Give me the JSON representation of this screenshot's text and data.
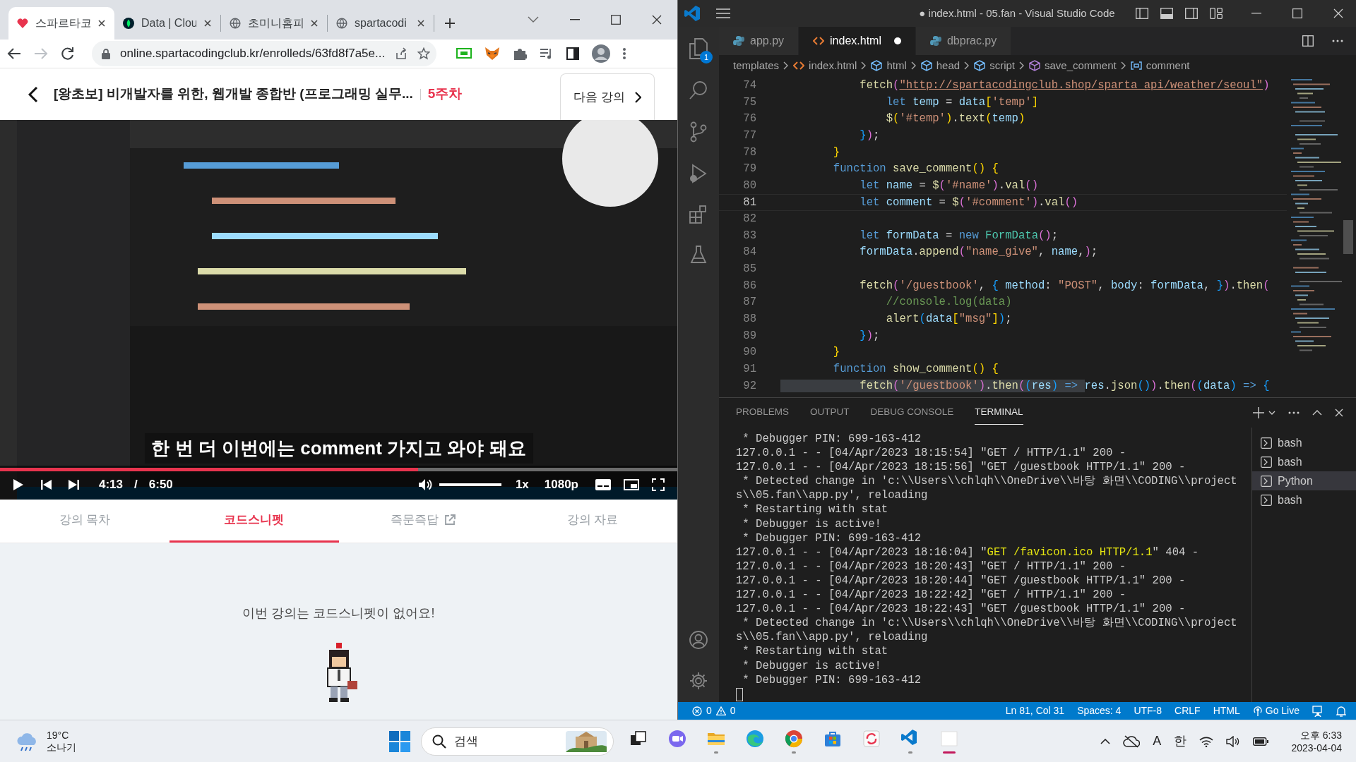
{
  "browser": {
    "tabs": [
      {
        "title": "스파르타코",
        "kind": "sparta",
        "selected": true
      },
      {
        "title": "Data | Clou",
        "kind": "leaf",
        "selected": false
      },
      {
        "title": "초미니홈피",
        "kind": "globe",
        "selected": false
      },
      {
        "title": "spartacodi",
        "kind": "globe",
        "selected": false
      }
    ],
    "nav": [
      {
        "kind": "back",
        "disabled": false
      },
      {
        "kind": "forward",
        "disabled": true
      },
      {
        "kind": "reload",
        "disabled": false
      }
    ],
    "url": "online.spartacodingclub.kr/enrolleds/63fd8f7a5e..."
  },
  "lecture": {
    "title": "[왕초보] 비개발자를 위한, 웹개발 종합반 (프로그래밍 실무...",
    "week": "5주차",
    "next_button": "다음 강의"
  },
  "player": {
    "subtitle": "한 번 더 이번에는 comment 가지고 와야 돼요",
    "progress": {
      "level": 0.617
    },
    "current_time": "4:13",
    "separator": "/",
    "duration": "6:50",
    "volume": {
      "level": 1
    },
    "speed": "1x",
    "quality": "1080p"
  },
  "lecture_tabs": [
    {
      "label": "강의 목차",
      "selected": false,
      "external": false
    },
    {
      "label": "코드스니펫",
      "selected": true,
      "external": false
    },
    {
      "label": "즉문즉답",
      "selected": false,
      "external": true
    },
    {
      "label": "강의 자료",
      "selected": false,
      "external": false
    }
  ],
  "empty_message": "이번 강의는 코드스니펫이 없어요!",
  "vscode": {
    "title": "● index.html - 05.fan - Visual Studio Code",
    "explorer_badge": "1",
    "tabs": [
      {
        "label": "app.py",
        "kind": "python",
        "selected": false,
        "dirty": false
      },
      {
        "label": "index.html",
        "kind": "html",
        "selected": true,
        "dirty": true
      },
      {
        "label": "dbprac.py",
        "kind": "python",
        "selected": false,
        "dirty": false
      }
    ],
    "breadcrumbs": [
      {
        "label": "templates",
        "kind": "folder"
      },
      {
        "label": "index.html",
        "kind": "html"
      },
      {
        "label": "html",
        "kind": "cube"
      },
      {
        "label": "head",
        "kind": "cube"
      },
      {
        "label": "script",
        "kind": "cube"
      },
      {
        "label": "save_comment",
        "kind": "method"
      },
      {
        "label": "comment",
        "kind": "variable"
      }
    ],
    "editor": {
      "lines": [
        {
          "n": "74",
          "current": false,
          "tokens": [
            {
              "text": "            fetch",
              "kind": "f"
            },
            {
              "text": "(",
              "kind": "b2"
            },
            {
              "text": "\"http://spartacodingclub.shop/sparta_api/weather/seoul\"",
              "kind": "u"
            },
            {
              "text": ")",
              "kind": "b2"
            }
          ]
        },
        {
          "n": "75",
          "current": false,
          "tokens": [
            {
              "text": "                let",
              "kind": "k"
            },
            {
              "text": " temp",
              "kind": "v"
            },
            {
              "text": " = ",
              "kind": "p"
            },
            {
              "text": "data",
              "kind": "v"
            },
            {
              "text": "[",
              "kind": "b1"
            },
            {
              "text": "'temp'",
              "kind": "s"
            },
            {
              "text": "]",
              "kind": "b1"
            }
          ]
        },
        {
          "n": "76",
          "current": false,
          "tokens": [
            {
              "text": "                $",
              "kind": "f"
            },
            {
              "text": "(",
              "kind": "b1"
            },
            {
              "text": "'#temp'",
              "kind": "s"
            },
            {
              "text": ")",
              "kind": "b1"
            },
            {
              "text": ".",
              "kind": "p"
            },
            {
              "text": "text",
              "kind": "f"
            },
            {
              "text": "(",
              "kind": "b1"
            },
            {
              "text": "temp",
              "kind": "v"
            },
            {
              "text": ")",
              "kind": "b1"
            }
          ]
        },
        {
          "n": "77",
          "current": false,
          "tokens": [
            {
              "text": "            }",
              "kind": "b3"
            },
            {
              "text": ")",
              "kind": "b2"
            },
            {
              "text": ";",
              "kind": "p"
            }
          ]
        },
        {
          "n": "78",
          "current": false,
          "tokens": [
            {
              "text": "        }",
              "kind": "b1"
            }
          ]
        },
        {
          "n": "79",
          "current": false,
          "tokens": [
            {
              "text": "        function",
              "kind": "k"
            },
            {
              "text": " save_comment",
              "kind": "f"
            },
            {
              "text": "()",
              "kind": "b1"
            },
            {
              "text": " {",
              "kind": "b1"
            }
          ]
        },
        {
          "n": "80",
          "current": false,
          "tokens": [
            {
              "text": "            let",
              "kind": "k"
            },
            {
              "text": " name",
              "kind": "v"
            },
            {
              "text": " = ",
              "kind": "p"
            },
            {
              "text": "$",
              "kind": "f"
            },
            {
              "text": "(",
              "kind": "b2"
            },
            {
              "text": "'#name'",
              "kind": "s"
            },
            {
              "text": ")",
              "kind": "b2"
            },
            {
              "text": ".",
              "kind": "p"
            },
            {
              "text": "val",
              "kind": "f"
            },
            {
              "text": "()",
              "kind": "b2"
            }
          ]
        },
        {
          "n": "81",
          "current": true,
          "tokens": [
            {
              "text": "            let",
              "kind": "k"
            },
            {
              "text": " comment",
              "kind": "v"
            },
            {
              "text": " = ",
              "kind": "p"
            },
            {
              "text": "$",
              "kind": "f"
            },
            {
              "text": "(",
              "kind": "b2"
            },
            {
              "text": "'#comment'",
              "kind": "s"
            },
            {
              "text": ")",
              "kind": "b2"
            },
            {
              "text": ".",
              "kind": "p"
            },
            {
              "text": "val",
              "kind": "f"
            },
            {
              "text": "()",
              "kind": "b2"
            }
          ]
        },
        {
          "n": "82",
          "current": false
        },
        {
          "n": "83",
          "current": false,
          "tokens": [
            {
              "text": "            let",
              "kind": "k"
            },
            {
              "text": " formData",
              "kind": "v"
            },
            {
              "text": " = ",
              "kind": "p"
            },
            {
              "text": "new",
              "kind": "k"
            },
            {
              "text": " FormData",
              "kind": "c"
            },
            {
              "text": "()",
              "kind": "b2"
            },
            {
              "text": ";",
              "kind": "p"
            }
          ]
        },
        {
          "n": "84",
          "current": false,
          "tokens": [
            {
              "text": "            formData",
              "kind": "v"
            },
            {
              "text": ".",
              "kind": "p"
            },
            {
              "text": "append",
              "kind": "f"
            },
            {
              "text": "(",
              "kind": "b2"
            },
            {
              "text": "\"name_give\"",
              "kind": "s"
            },
            {
              "text": ", ",
              "kind": "p"
            },
            {
              "text": "name",
              "kind": "v"
            },
            {
              "text": ",",
              "kind": "p"
            },
            {
              "text": ")",
              "kind": "b2"
            },
            {
              "text": ";",
              "kind": "p"
            }
          ]
        },
        {
          "n": "85",
          "current": false
        },
        {
          "n": "86",
          "current": false,
          "tokens": [
            {
              "text": "            fetch",
              "kind": "f"
            },
            {
              "text": "(",
              "kind": "b2"
            },
            {
              "text": "'/guestbook'",
              "kind": "s"
            },
            {
              "text": ", ",
              "kind": "p"
            },
            {
              "text": "{",
              "kind": "b3"
            },
            {
              "text": " method",
              "kind": "v"
            },
            {
              "text": ": ",
              "kind": "p"
            },
            {
              "text": "\"POST\"",
              "kind": "s"
            },
            {
              "text": ", ",
              "kind": "p"
            },
            {
              "text": "body",
              "kind": "v"
            },
            {
              "text": ": ",
              "kind": "p"
            },
            {
              "text": "formData",
              "kind": "v"
            },
            {
              "text": ", ",
              "kind": "p"
            },
            {
              "text": "}",
              "kind": "b3"
            },
            {
              "text": ")",
              "kind": "b2"
            },
            {
              "text": ".",
              "kind": "p"
            },
            {
              "text": "then",
              "kind": "f"
            },
            {
              "text": "(",
              "kind": "b2"
            }
          ]
        },
        {
          "n": "87",
          "current": false,
          "tokens": [
            {
              "text": "                //console.log(data)",
              "kind": "m"
            }
          ]
        },
        {
          "n": "88",
          "current": false,
          "tokens": [
            {
              "text": "                alert",
              "kind": "f"
            },
            {
              "text": "(",
              "kind": "b3"
            },
            {
              "text": "data",
              "kind": "v"
            },
            {
              "text": "[",
              "kind": "b1"
            },
            {
              "text": "\"msg\"",
              "kind": "s"
            },
            {
              "text": "]",
              "kind": "b1"
            },
            {
              "text": ")",
              "kind": "b3"
            },
            {
              "text": ";",
              "kind": "p"
            }
          ]
        },
        {
          "n": "89",
          "current": false,
          "tokens": [
            {
              "text": "            }",
              "kind": "b3"
            },
            {
              "text": ")",
              "kind": "b2"
            },
            {
              "text": ";",
              "kind": "p"
            }
          ]
        },
        {
          "n": "90",
          "current": false,
          "tokens": [
            {
              "text": "        }",
              "kind": "b1"
            }
          ]
        },
        {
          "n": "91",
          "current": false,
          "tokens": [
            {
              "text": "        function",
              "kind": "k"
            },
            {
              "text": " show_comment",
              "kind": "f"
            },
            {
              "text": "()",
              "kind": "b1"
            },
            {
              "text": " {",
              "kind": "b1"
            }
          ]
        },
        {
          "n": "92",
          "current": false,
          "selection": [
            {
              "text": "            fetch",
              "kind": "f"
            },
            {
              "text": "(",
              "kind": "b2"
            },
            {
              "text": "'/guestbook'",
              "kind": "s"
            },
            {
              "text": ")",
              "kind": "b2"
            },
            {
              "text": ".",
              "kind": "p"
            },
            {
              "text": "then",
              "kind": "f"
            },
            {
              "text": "(",
              "kind": "b2"
            },
            {
              "text": "(",
              "kind": "b3"
            },
            {
              "text": "res",
              "kind": "v"
            },
            {
              "text": ")",
              "kind": "b3"
            },
            {
              "text": " => ",
              "kind": "k"
            }
          ],
          "tokens": [
            {
              "text": "res",
              "kind": "v"
            },
            {
              "text": ".",
              "kind": "p"
            },
            {
              "text": "json",
              "kind": "f"
            },
            {
              "text": "()",
              "kind": "b3"
            },
            {
              "text": ")",
              "kind": "b2"
            },
            {
              "text": ".",
              "kind": "p"
            },
            {
              "text": "then",
              "kind": "f"
            },
            {
              "text": "(",
              "kind": "b2"
            },
            {
              "text": "(",
              "kind": "b3"
            },
            {
              "text": "data",
              "kind": "v"
            },
            {
              "text": ")",
              "kind": "b3"
            },
            {
              "text": " => ",
              "kind": "k"
            },
            {
              "text": "{",
              "kind": "b3"
            }
          ]
        }
      ]
    },
    "panel": {
      "tabs": [
        {
          "label": "PROBLEMS",
          "selected": false
        },
        {
          "label": "OUTPUT",
          "selected": false
        },
        {
          "label": "DEBUG CONSOLE",
          "selected": false
        },
        {
          "label": "TERMINAL",
          "selected": true
        }
      ],
      "terminal_lines": [
        {
          "parts": [
            {
              "text": " * Debugger PIN: 699-163-412",
              "kind": "plain"
            }
          ]
        },
        {
          "parts": [
            {
              "text": "127.0.0.1 - - [04/Apr/2023 18:15:54] \"GET / HTTP/1.1\" 200 -",
              "kind": "plain"
            }
          ]
        },
        {
          "parts": [
            {
              "text": "127.0.0.1 - - [04/Apr/2023 18:15:56] \"GET /guestbook HTTP/1.1\" 200 -",
              "kind": "plain"
            }
          ]
        },
        {
          "parts": [
            {
              "text": " * Detected change in 'c:\\\\Users\\\\chlqh\\\\OneDrive\\\\바탕 화면\\\\CODING\\\\project",
              "kind": "plain"
            }
          ]
        },
        {
          "parts": [
            {
              "text": "s\\\\05.fan\\\\app.py', reloading",
              "kind": "plain"
            }
          ]
        },
        {
          "parts": [
            {
              "text": " * Restarting with stat",
              "kind": "plain"
            }
          ]
        },
        {
          "parts": [
            {
              "text": " * Debugger is active!",
              "kind": "plain"
            }
          ]
        },
        {
          "parts": [
            {
              "text": " * Debugger PIN: 699-163-412",
              "kind": "plain"
            }
          ]
        },
        {
          "parts": [
            {
              "text": "127.0.0.1 - - [04/Apr/2023 18:16:04] \"",
              "kind": "plain"
            },
            {
              "text": "GET /favicon.ico HTTP/1.1",
              "kind": "warn"
            },
            {
              "text": "\" 404 -",
              "kind": "plain"
            }
          ]
        },
        {
          "parts": [
            {
              "text": "127.0.0.1 - - [04/Apr/2023 18:20:43] \"GET / HTTP/1.1\" 200 -",
              "kind": "plain"
            }
          ]
        },
        {
          "parts": [
            {
              "text": "127.0.0.1 - - [04/Apr/2023 18:20:44] \"GET /guestbook HTTP/1.1\" 200 -",
              "kind": "plain"
            }
          ]
        },
        {
          "parts": [
            {
              "text": "127.0.0.1 - - [04/Apr/2023 18:22:42] \"GET / HTTP/1.1\" 200 -",
              "kind": "plain"
            }
          ]
        },
        {
          "parts": [
            {
              "text": "127.0.0.1 - - [04/Apr/2023 18:22:43] \"GET /guestbook HTTP/1.1\" 200 -",
              "kind": "plain"
            }
          ]
        },
        {
          "parts": [
            {
              "text": " * Detected change in 'c:\\\\Users\\\\chlqh\\\\OneDrive\\\\바탕 화면\\\\CODING\\\\project",
              "kind": "plain"
            }
          ]
        },
        {
          "parts": [
            {
              "text": "s\\\\05.fan\\\\app.py', reloading",
              "kind": "plain"
            }
          ]
        },
        {
          "parts": [
            {
              "text": " * Restarting with stat",
              "kind": "plain"
            }
          ]
        },
        {
          "parts": [
            {
              "text": " * Debugger is active!",
              "kind": "plain"
            }
          ]
        },
        {
          "parts": [
            {
              "text": " * Debugger PIN: 699-163-412",
              "kind": "plain"
            }
          ]
        }
      ],
      "terminals": [
        {
          "label": "bash",
          "selected": false
        },
        {
          "label": "bash",
          "selected": false
        },
        {
          "label": "Python",
          "selected": true
        },
        {
          "label": "bash",
          "selected": false
        }
      ]
    },
    "status_bar": {
      "errors": "0",
      "warnings": "0",
      "items": [
        "Ln 81, Col 31",
        "Spaces: 4",
        "UTF-8",
        "CRLF",
        "HTML"
      ],
      "go_live": "Go Live"
    }
  },
  "taskbar": {
    "weather": {
      "temperature": "19°C",
      "condition": "소나기"
    },
    "search": {
      "placeholder": "검색"
    },
    "apps": [
      {
        "kind": "task-view",
        "running": false,
        "active": false
      },
      {
        "kind": "chat",
        "running": false,
        "active": false
      },
      {
        "kind": "folder",
        "running": true,
        "active": false
      },
      {
        "kind": "edge",
        "running": false,
        "active": false
      },
      {
        "kind": "chrome",
        "running": true,
        "active": false
      },
      {
        "kind": "store",
        "running": false,
        "active": false
      },
      {
        "kind": "sync",
        "running": false,
        "active": false
      },
      {
        "kind": "vscode",
        "running": true,
        "active": false
      },
      {
        "kind": "blank",
        "running": true,
        "active": true
      }
    ],
    "input_mode": "A",
    "language": "한",
    "time": "오후 6:33",
    "date": "2023-04-04"
  }
}
